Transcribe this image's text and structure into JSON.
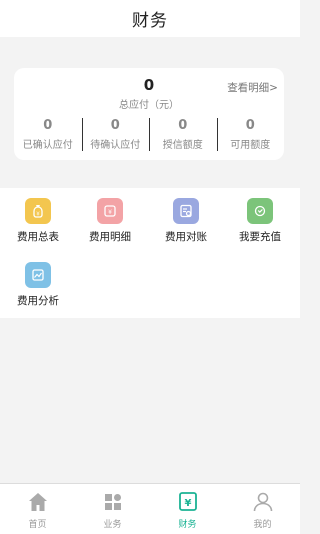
{
  "header": {
    "title": "财务"
  },
  "summary": {
    "total_value": "0",
    "total_label": "总应付（元）",
    "detail_link": "查看明细>",
    "stats": [
      {
        "value": "0",
        "label": "已确认应付"
      },
      {
        "value": "0",
        "label": "待确认应付"
      },
      {
        "value": "0",
        "label": "授信额度"
      },
      {
        "value": "0",
        "label": "可用额度"
      }
    ]
  },
  "menu": {
    "items": [
      {
        "label": "费用总表",
        "icon": "money-bag-icon",
        "color": "#f3c64f"
      },
      {
        "label": "费用明细",
        "icon": "ticket-icon",
        "color": "#f3a3a6"
      },
      {
        "label": "费用对账",
        "icon": "reconcile-icon",
        "color": "#9aa8e0"
      },
      {
        "label": "我要充值",
        "icon": "recharge-icon",
        "color": "#7cc47a"
      },
      {
        "label": "费用分析",
        "icon": "analysis-icon",
        "color": "#7fc1e6"
      }
    ]
  },
  "tabbar": {
    "active_color": "#1bb394",
    "inactive_color": "#aaaaaa",
    "items": [
      {
        "label": "首页",
        "icon": "home-icon",
        "active": false
      },
      {
        "label": "业务",
        "icon": "grid-icon",
        "active": false
      },
      {
        "label": "财务",
        "icon": "finance-icon",
        "active": true
      },
      {
        "label": "我的",
        "icon": "user-icon",
        "active": false
      }
    ]
  }
}
